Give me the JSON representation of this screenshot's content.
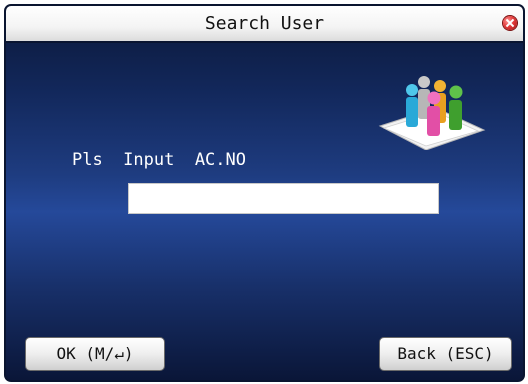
{
  "window": {
    "title": "Search User"
  },
  "form": {
    "prompt": "Pls  Input  AC.NO",
    "input_value": ""
  },
  "buttons": {
    "ok_label": "OK (M/↵)",
    "back_label": "Back (ESC)"
  },
  "icons": {
    "close": "close-icon",
    "illustration": "users-group-icon"
  },
  "colors": {
    "background_top": "#0b1838",
    "background_mid": "#25499a",
    "close_red": "#e23a3a"
  }
}
